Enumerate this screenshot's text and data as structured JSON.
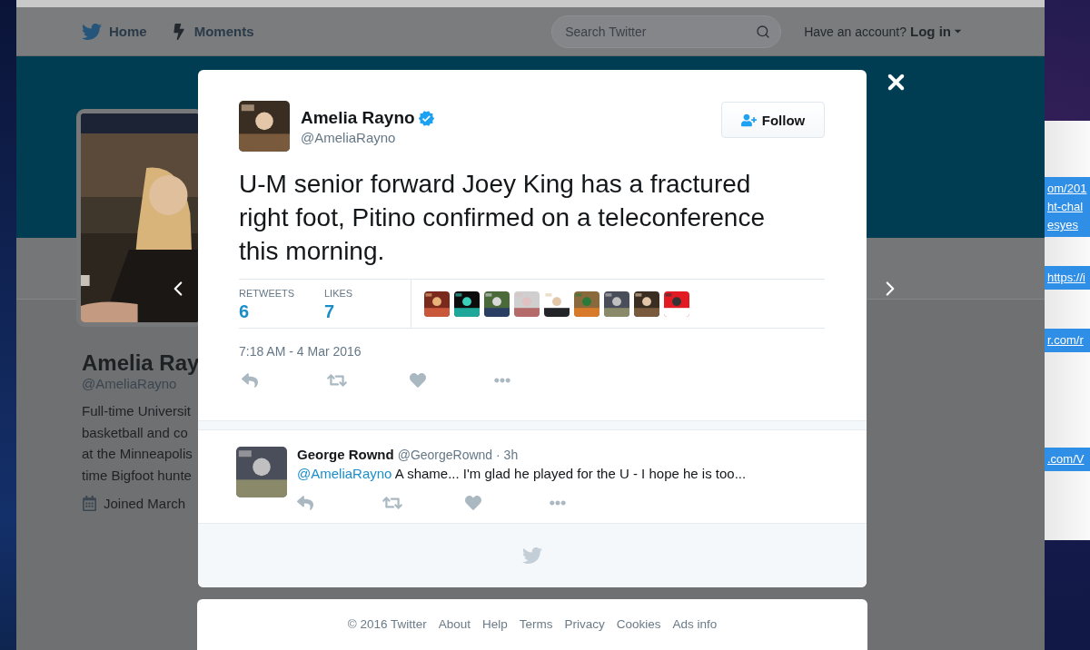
{
  "nav": {
    "items": [
      {
        "label": "Home",
        "kind": "bird"
      },
      {
        "label": "Moments",
        "kind": "bolt"
      }
    ],
    "search": {
      "placeholder": "Search Twitter"
    },
    "account_prompt": "Have an account?",
    "login": "Log in"
  },
  "profile": {
    "name": "Amelia Ray",
    "handle": "@AmeliaRayno",
    "bio_lines": [
      "Full-time Universit",
      "basketball and co",
      "at the Minneapolis",
      "time Bigfoot hunte"
    ],
    "joined": "Joined March"
  },
  "tweet": {
    "name": "Amelia Rayno",
    "verified": true,
    "handle": "@AmeliaRayno",
    "follow": "Follow",
    "text": "U-M senior forward Joey King has a fractured right foot, Pitino confirmed on a teleconference this morning.",
    "stats": [
      {
        "label": "RETWEETS",
        "value": "6"
      },
      {
        "label": "LIKES",
        "value": "7"
      }
    ],
    "date": "7:18 AM - 4 Mar 2016"
  },
  "replies": [
    {
      "name": "George Rownd",
      "meta": "@GeorgeRownd · 3h",
      "mention": "@AmeliaRayno",
      "text": "A shame... I'm glad he played for the U - I hope he is too..."
    }
  ],
  "footer": {
    "links": [
      "© 2016 Twitter",
      "About",
      "Help",
      "Terms",
      "Privacy",
      "Cookies",
      "Ads info"
    ]
  },
  "side_window": {
    "links": [
      {
        "lines": [
          "om/201",
          "ht-chal",
          "esyes"
        ]
      },
      {
        "lines": [
          "https://i"
        ]
      },
      {
        "lines": [
          "r.com/r"
        ]
      },
      {
        "lines": [
          ".com/V"
        ]
      }
    ]
  }
}
